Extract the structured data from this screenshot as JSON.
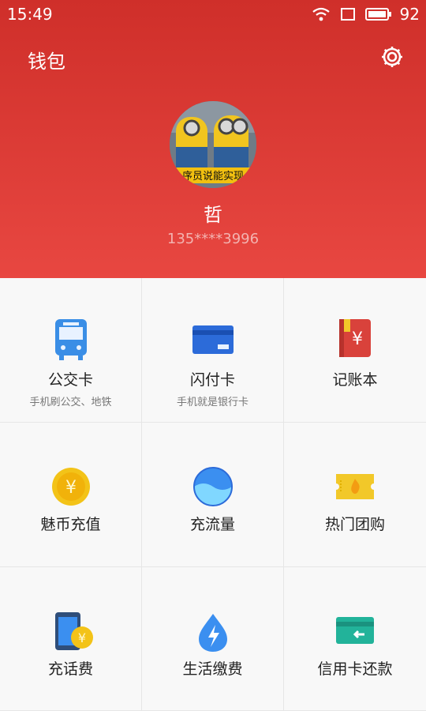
{
  "status_bar": {
    "time": "15:49",
    "battery": "92"
  },
  "header": {
    "title": "钱包",
    "avatar_text": "序员说能实现",
    "name": "哲",
    "phone": "135****3996"
  },
  "tiles": [
    {
      "label": "公交卡",
      "sub": "手机刷公交、地铁",
      "icon": "bus-icon"
    },
    {
      "label": "闪付卡",
      "sub": "手机就是银行卡",
      "icon": "card-icon"
    },
    {
      "label": "记账本",
      "sub": "",
      "icon": "ledger-icon"
    },
    {
      "label": "魅币充值",
      "sub": "",
      "icon": "coin-icon"
    },
    {
      "label": "充流量",
      "sub": "",
      "icon": "data-icon"
    },
    {
      "label": "热门团购",
      "sub": "",
      "icon": "ticket-icon"
    },
    {
      "label": "充话费",
      "sub": "",
      "icon": "phone-bill-icon"
    },
    {
      "label": "生活缴费",
      "sub": "",
      "icon": "utility-icon"
    },
    {
      "label": "信用卡还款",
      "sub": "",
      "icon": "credit-card-icon"
    }
  ],
  "colors": {
    "header_top": "#cf2f2a",
    "header_bottom": "#e84741",
    "bus": "#3a8ee6",
    "card": "#2c6bd9",
    "ledger": "#d9423b",
    "coin": "#f3c318",
    "data": "#3b8ff0",
    "ticket": "#f2c829",
    "credit": "#22b39a"
  }
}
